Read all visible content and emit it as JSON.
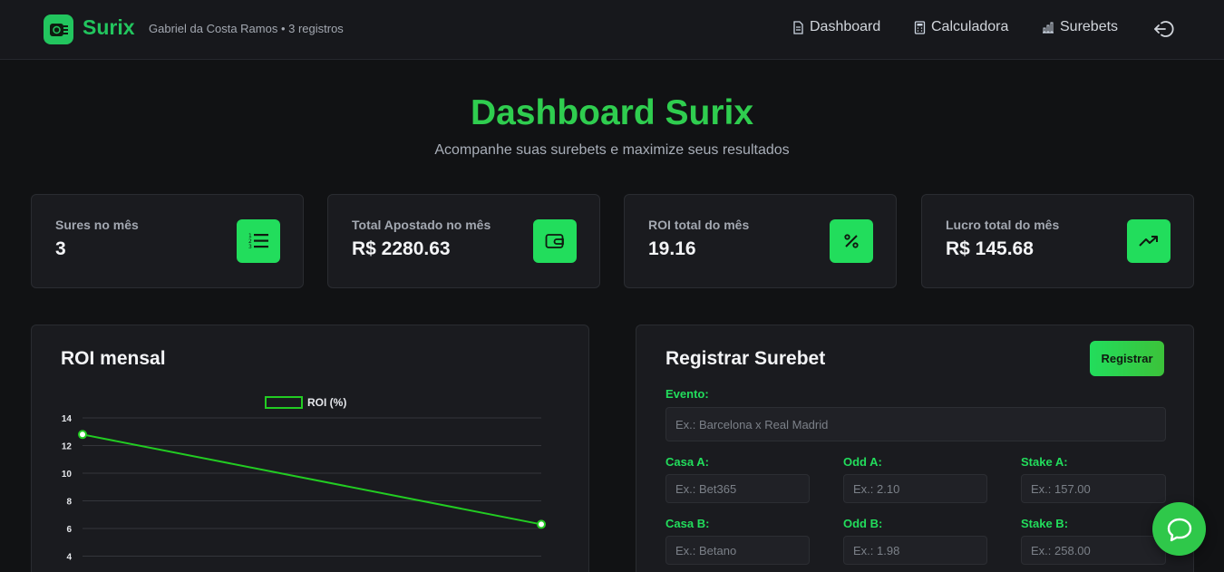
{
  "header": {
    "brand": "Surix",
    "user_meta": "Gabriel da Costa Ramos • 3 registros",
    "nav": [
      {
        "label": "Dashboard",
        "icon": "document-icon"
      },
      {
        "label": "Calculadora",
        "icon": "calculator-icon"
      },
      {
        "label": "Surebets",
        "icon": "bar-chart-icon"
      }
    ],
    "logout_icon": "logout-icon"
  },
  "hero": {
    "title": "Dashboard Surix",
    "subtitle": "Acompanhe suas surebets e maximize seus resultados"
  },
  "stats": [
    {
      "label": "Sures no mês",
      "value": "3",
      "icon": "numbered-list-icon"
    },
    {
      "label": "Total Apostado no mês",
      "value": "R$ 2280.63",
      "icon": "wallet-icon"
    },
    {
      "label": "ROI total do mês",
      "value": "19.16",
      "icon": "percent-icon"
    },
    {
      "label": "Lucro total do mês",
      "value": "R$ 145.68",
      "icon": "trending-up-icon"
    }
  ],
  "roi_panel": {
    "title": "ROI mensal"
  },
  "chart_data": {
    "type": "line",
    "title": "",
    "xlabel": "",
    "ylabel": "",
    "series": [
      {
        "name": "ROI (%)",
        "values": [
          12.8,
          6.3
        ]
      }
    ],
    "yticks": [
      "14",
      "12",
      "10",
      "8",
      "6",
      "4"
    ],
    "ylim": [
      4,
      14
    ],
    "grid": true,
    "legend": "top-center",
    "color": "#22cc22"
  },
  "form": {
    "title": "Registrar Surebet",
    "submit_label": "Registrar",
    "evento_label": "Evento:",
    "evento_placeholder": "Ex.: Barcelona x Real Madrid",
    "casa_a_label": "Casa A:",
    "casa_a_placeholder": "Ex.: Bet365",
    "odd_a_label": "Odd A:",
    "odd_a_placeholder": "Ex.: 2.10",
    "stake_a_label": "Stake A:",
    "stake_a_placeholder": "Ex.: 157.00",
    "casa_b_label": "Casa B:",
    "casa_b_placeholder": "Ex.: Betano",
    "odd_b_label": "Odd B:",
    "odd_b_placeholder": "Ex.: 1.98",
    "stake_b_label": "Stake B:",
    "stake_b_placeholder": "Ex.: 258.00"
  },
  "colors": {
    "accent": "#22dd5c",
    "background": "#111214",
    "card": "#1a1b1f"
  }
}
